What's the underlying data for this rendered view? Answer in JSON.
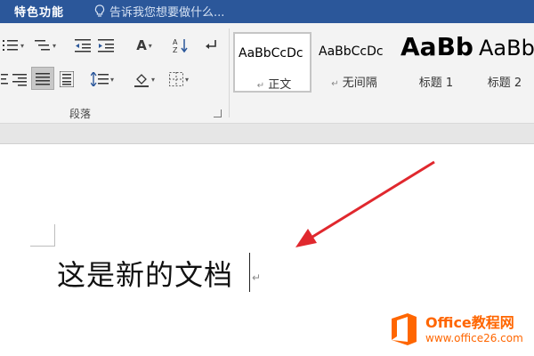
{
  "titlebar": {
    "feature_tab": "特色功能",
    "tell_me": "告诉我您想要做什么..."
  },
  "ribbon": {
    "paragraph_group_label": "段落",
    "styles": [
      {
        "sample": "AaBbCcDc",
        "name": "正文",
        "selected": true
      },
      {
        "sample": "AaBbCcDc",
        "name": "无间隔"
      },
      {
        "sample": "AaBb",
        "name": "标题 1"
      },
      {
        "sample": "AaBb",
        "name": "标题 2"
      }
    ],
    "para_mark": "↵"
  },
  "document": {
    "text": "这是新的文档",
    "paragraph_mark": "↵"
  },
  "watermark": {
    "brand": "Office教程网",
    "url": "www.office26.com"
  },
  "colors": {
    "ribbon_blue": "#2b579a",
    "arrow_red": "#e0282e",
    "watermark_orange": "#ff6600"
  }
}
